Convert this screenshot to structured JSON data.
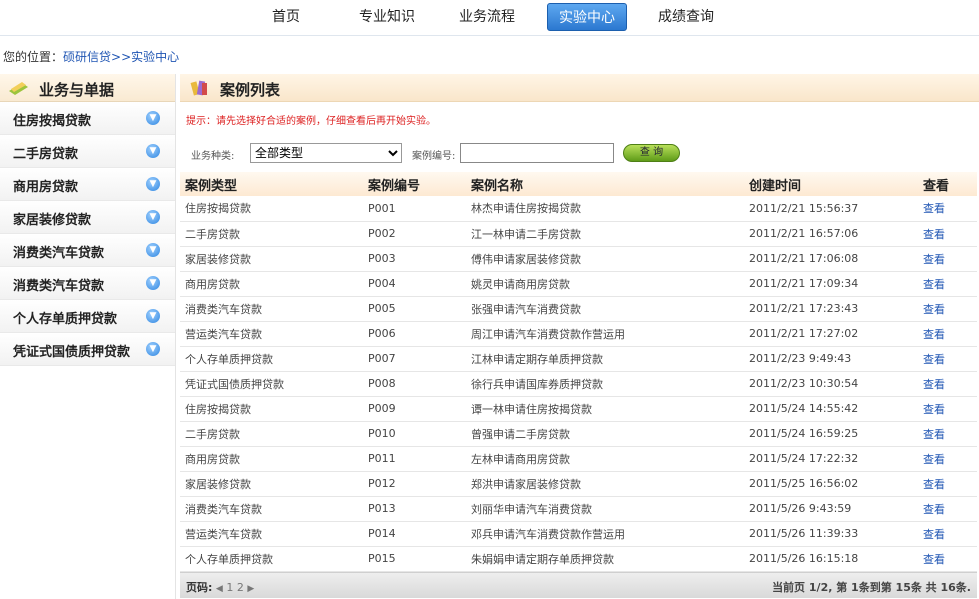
{
  "nav": {
    "items": [
      {
        "label": "首页"
      },
      {
        "label": "专业知识"
      },
      {
        "label": "业务流程"
      },
      {
        "label": "实验中心"
      },
      {
        "label": "成绩查询"
      }
    ]
  },
  "location": {
    "prefix": "您的位置：",
    "path": "硕研信贷>>实验中心"
  },
  "sidebar": {
    "title": "业务与单据",
    "items": [
      {
        "label": "住房按揭贷款"
      },
      {
        "label": "二手房贷款"
      },
      {
        "label": "商用房贷款"
      },
      {
        "label": "家居装修贷款"
      },
      {
        "label": "消费类汽车贷款"
      },
      {
        "label": "消费类汽车贷款"
      },
      {
        "label": "个人存单质押贷款"
      },
      {
        "label": "凭证式国债质押贷款"
      }
    ]
  },
  "main": {
    "title": "案例列表",
    "tip": "提示：请先选择好合适的案例，仔细查看后再开始实验。",
    "search": {
      "type_label": "业务种类:",
      "type_value": "全部类型",
      "code_label": "案例编号:",
      "code_value": "",
      "button": "查 询"
    },
    "columns": [
      "案例类型",
      "案例编号",
      "案例名称",
      "创建时间",
      "查看"
    ],
    "rows": [
      [
        "住房按揭贷款",
        "P001",
        "林杰申请住房按揭贷款",
        "2011/2/21 15:56:37",
        "查看"
      ],
      [
        "二手房贷款",
        "P002",
        "江一林申请二手房贷款",
        "2011/2/21 16:57:06",
        "查看"
      ],
      [
        "家居装修贷款",
        "P003",
        "傅伟申请家居装修贷款",
        "2011/2/21 17:06:08",
        "查看"
      ],
      [
        "商用房贷款",
        "P004",
        "姚灵申请商用房贷款",
        "2011/2/21 17:09:34",
        "查看"
      ],
      [
        "消费类汽车贷款",
        "P005",
        "张强申请汽车消费贷款",
        "2011/2/21 17:23:43",
        "查看"
      ],
      [
        "营运类汽车贷款",
        "P006",
        "周江申请汽车消费贷款作营运用",
        "2011/2/21 17:27:02",
        "查看"
      ],
      [
        "个人存单质押贷款",
        "P007",
        "江林申请定期存单质押贷款",
        "2011/2/23 9:49:43",
        "查看"
      ],
      [
        "凭证式国债质押贷款",
        "P008",
        "徐行兵申请国库券质押贷款",
        "2011/2/23 10:30:54",
        "查看"
      ],
      [
        "住房按揭贷款",
        "P009",
        "谭一林申请住房按揭贷款",
        "2011/5/24 14:55:42",
        "查看"
      ],
      [
        "二手房贷款",
        "P010",
        "曾强申请二手房贷款",
        "2011/5/24 16:59:25",
        "查看"
      ],
      [
        "商用房贷款",
        "P011",
        "左林申请商用房贷款",
        "2011/5/24 17:22:32",
        "查看"
      ],
      [
        "家居装修贷款",
        "P012",
        "郑洪申请家居装修贷款",
        "2011/5/25 16:56:02",
        "查看"
      ],
      [
        "消费类汽车贷款",
        "P013",
        "刘丽华申请汽车消费贷款",
        "2011/5/26 9:43:59",
        "查看"
      ],
      [
        "营运类汽车贷款",
        "P014",
        "邓兵申请汽车消费贷款作营运用",
        "2011/5/26 11:39:33",
        "查看"
      ],
      [
        "个人存单质押贷款",
        "P015",
        "朱娟娟申请定期存单质押贷款",
        "2011/5/26 16:15:18",
        "查看"
      ]
    ],
    "pager": {
      "label": "页码:",
      "prev": "◀",
      "pages": "1 2",
      "next": "▶",
      "summary": "当前页 1/2, 第 1条到第 15条 共 16条."
    }
  }
}
